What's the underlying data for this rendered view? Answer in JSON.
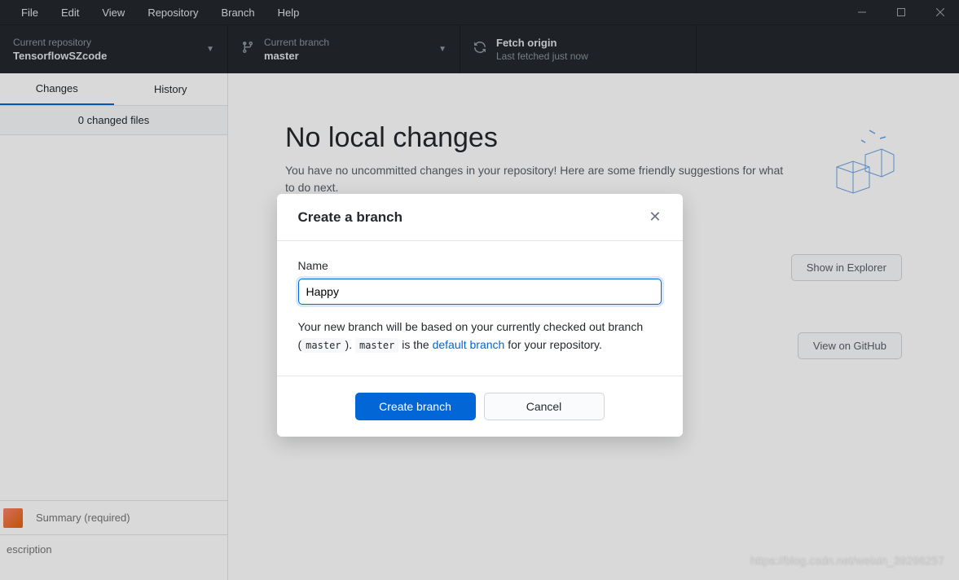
{
  "menu": {
    "items": [
      "File",
      "Edit",
      "View",
      "Repository",
      "Branch",
      "Help"
    ]
  },
  "toolbar": {
    "repo": {
      "label": "Current repository",
      "value": "TensorflowSZcode"
    },
    "branch": {
      "label": "Current branch",
      "value": "master"
    },
    "fetch": {
      "label": "Fetch origin",
      "value": "Last fetched just now"
    }
  },
  "sidebar": {
    "tabs": {
      "changes": "Changes",
      "history": "History"
    },
    "changed_files": "0 changed files",
    "summary_placeholder": "Summary (required)",
    "description_placeholder": "escription"
  },
  "main": {
    "heading": "No local changes",
    "subtext": "You have no uncommitted changes in your repository! Here are some friendly suggestions for what to do next.",
    "explorer_btn": "Show in Explorer",
    "github_btn": "View on GitHub"
  },
  "dialog": {
    "title": "Create a branch",
    "name_label": "Name",
    "name_value": "Happy",
    "hint_pre": "Your new branch will be based on your currently checked out branch (",
    "hint_code1": "master",
    "hint_mid": "). ",
    "hint_code2": "master",
    "hint_mid2": " is the ",
    "hint_link": "default branch",
    "hint_post": " for your repository.",
    "create_btn": "Create branch",
    "cancel_btn": "Cancel"
  },
  "watermark": "https://blog.csdn.net/weixin_39296257"
}
